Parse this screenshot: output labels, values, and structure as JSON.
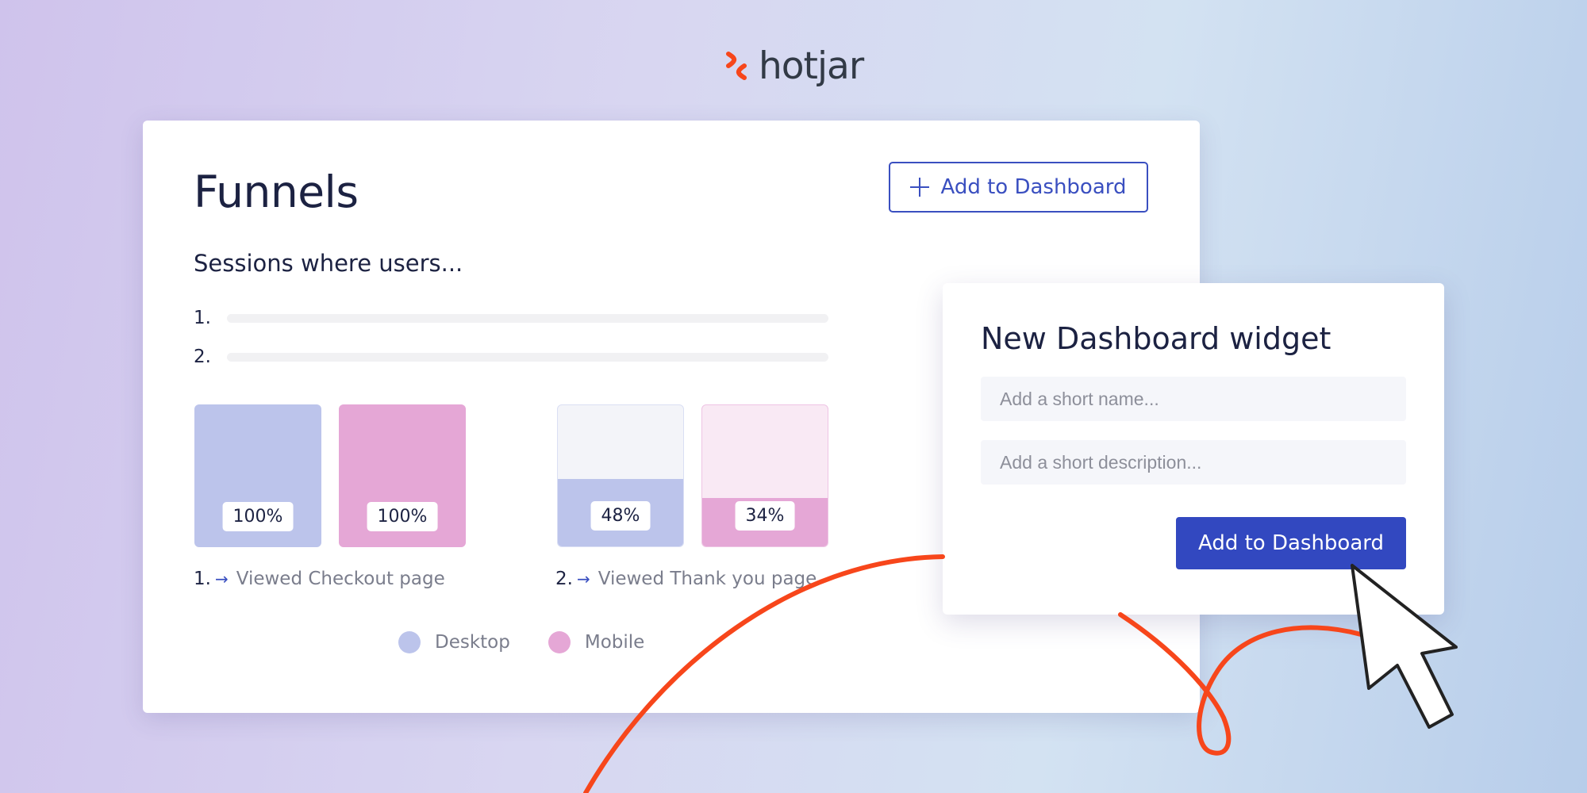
{
  "brand": {
    "name": "hotjar",
    "accent": "#f7461b"
  },
  "funnels": {
    "title": "Funnels",
    "add_button_label": "Add to Dashboard",
    "subtitle": "Sessions where users...",
    "steps": [
      {
        "num": "1.",
        "caption": "Viewed Checkout page"
      },
      {
        "num": "2.",
        "caption": "Viewed Thank you page"
      }
    ],
    "bars": [
      {
        "step": 1,
        "segment": "Desktop",
        "percent": 100,
        "label": "100%"
      },
      {
        "step": 1,
        "segment": "Mobile",
        "percent": 100,
        "label": "100%"
      },
      {
        "step": 2,
        "segment": "Desktop",
        "percent": 48,
        "label": "48%"
      },
      {
        "step": 2,
        "segment": "Mobile",
        "percent": 34,
        "label": "34%"
      }
    ],
    "legend": [
      {
        "label": "Desktop",
        "color": "#bcc4eb"
      },
      {
        "label": "Mobile",
        "color": "#e5a7d6"
      }
    ]
  },
  "widget": {
    "title": "New Dashboard widget",
    "name_placeholder": "Add a short name...",
    "description_placeholder": "Add a short description...",
    "submit_label": "Add to Dashboard"
  },
  "colors": {
    "desktop": "#bcc4eb",
    "desktop_light": "#f3f4f9",
    "mobile": "#e5a7d6",
    "mobile_light": "#f9e9f4",
    "primary": "#3248c0",
    "heading": "#1c2242"
  }
}
